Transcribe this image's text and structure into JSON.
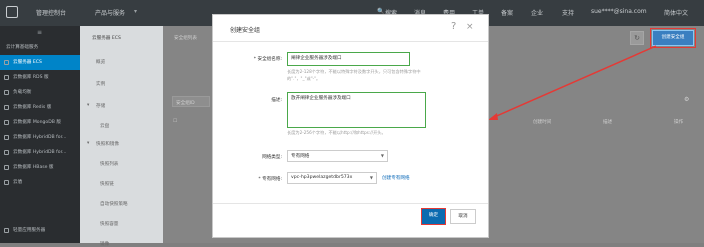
{
  "topbar": {
    "console": "管理控制台",
    "products": "产品与服务",
    "search": "搜索",
    "messages": "消息",
    "billing": "费用",
    "tickets": "工单",
    "filing": "备案",
    "enterprise": "企业",
    "support": "支持",
    "user": "sue****@sina.com",
    "language": "简体中文"
  },
  "sidebar": {
    "items": [
      "云计算基础服务",
      "云服务器 ECS",
      "云数据库 RDS 版",
      "负载均衡",
      "云数据库 Redis 版",
      "云数据库 MongoDB 版",
      "云数据库 HybridDB for...",
      "云数据库 HybridDB for...",
      "云数据库 HBase 版",
      "云盾",
      "轻量应用服务器"
    ]
  },
  "subnav": {
    "title": "云服务器 ECS",
    "overview": "概览",
    "instances": "实例",
    "storage": "存储",
    "cloud_disk": "云盘",
    "snapshots": "快照和镜像",
    "snapshot_list": "快照列表",
    "snapshot_chain": "快照链",
    "auto_policy": "自动快照策略",
    "snapshot_capacity": "快照容量",
    "images": "镜像"
  },
  "main": {
    "page_title": "安全组列表",
    "filter_select": "安全组ID",
    "col_time": "创建时间",
    "col_desc": "描述",
    "col_action": "操作",
    "refresh_icon": "↻",
    "create_button": "创建安全组"
  },
  "modal": {
    "title": "创建安全组",
    "help": "?",
    "close": "×",
    "name_label": "* 安全组名称:",
    "name_value": "阐律企业服务器涉及端口",
    "name_hint_1": "长度为2-128个字符，不能以特殊字符及数字开头，只可包含特殊字符中",
    "name_hint_2": "的\".\"，\"_\"或\"-\"。",
    "desc_label": "描述:",
    "desc_value": "放开阐律企业服务器涉及端口",
    "desc_hint": "长度为2-256个字符，不能以http://和https://开头。",
    "network_label": "网络类型:",
    "network_value": "专有网络",
    "vpc_label": "* 专有网络:",
    "vpc_value": "vpc-hp3pwelazgetdbr573x",
    "vpc_link": "创建专有网络",
    "ok": "确定",
    "cancel": "取消"
  },
  "colors": {
    "accent": "#0a6bb0",
    "highlight": "#e53935",
    "sidebar_bg": "#2a2d30",
    "topbar_bg": "#373d41"
  }
}
